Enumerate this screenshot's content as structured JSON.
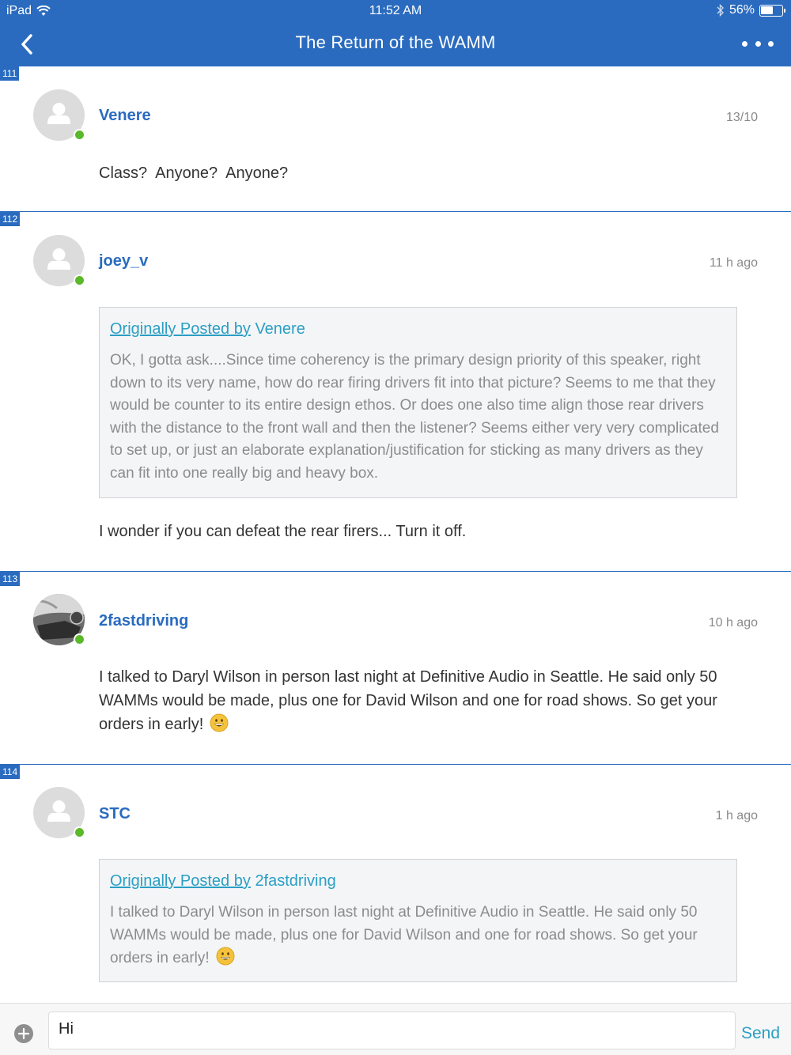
{
  "status_bar": {
    "device": "iPad",
    "time": "11:52 AM",
    "battery": "56%",
    "battery_level": 0.56
  },
  "nav": {
    "title": "The Return of the WAMM",
    "back_icon": "chevron-left-icon",
    "more_icon": "more-horizontal-icon"
  },
  "posts": [
    {
      "number": "111",
      "author": "Venere",
      "time": "13/10",
      "body": "Class?  Anyone?  Anyone?"
    },
    {
      "number": "112",
      "author": "joey_v",
      "time": "11 h ago",
      "quote": {
        "prefix": "Originally Posted by",
        "author": "Venere",
        "text": "OK, I gotta ask....Since time coherency is the primary design priority of this speaker, right down to its very name, how do rear firing drivers fit into that picture?  Seems to me that they would be counter to its entire design ethos. Or does one also time align those rear drivers with the distance to the front wall and then the listener? Seems either very very complicated to set up,  or just an elaborate explanation/justification for sticking as many drivers as they can fit into one really big and heavy box."
      },
      "body": "I wonder if you can defeat the rear firers... Turn it off."
    },
    {
      "number": "113",
      "author": "2fastdriving",
      "time": "10 h ago",
      "body": "I talked to Daryl Wilson in person last night at Definitive Audio in Seattle.  He said only 50 WAMMs would be made, plus one for David Wilson and one for road shows.  So get your orders in early!"
    },
    {
      "number": "114",
      "author": "STC",
      "time": "1 h ago",
      "quote": {
        "prefix": "Originally Posted by",
        "author": "2fastdriving",
        "text": "I talked to Daryl Wilson in person last night at Definitive Audio in Seattle.  He said only 50 WAMMs would be made, plus one for David Wilson and one for road shows.  So get your orders in early!"
      }
    }
  ],
  "composer": {
    "value": "Hi",
    "send_label": "Send",
    "add_icon": "plus-circle-icon"
  },
  "colors": {
    "accent": "#2a6bbf",
    "online": "#5cb82b",
    "link": "#2a9fc4"
  }
}
